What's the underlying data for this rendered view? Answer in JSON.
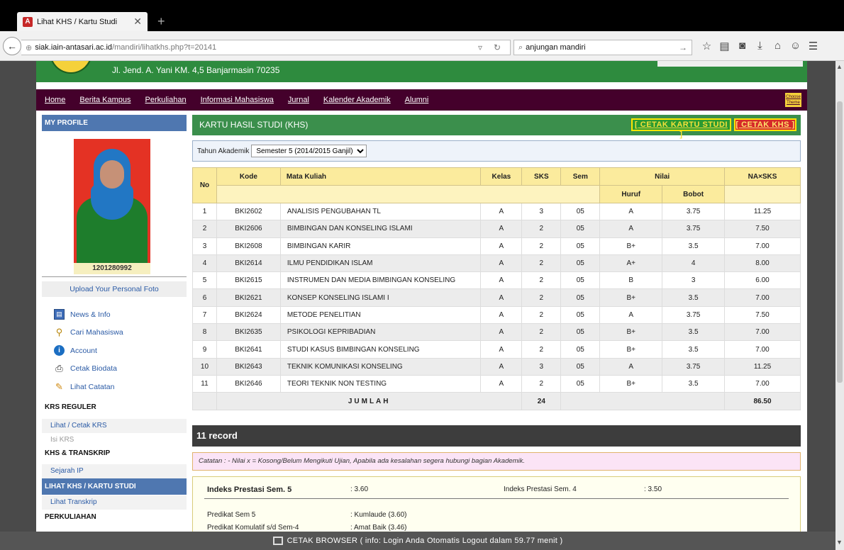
{
  "browser": {
    "tab_title": "Lihat KHS / Kartu Studi",
    "tab_favicon": "A",
    "url_host": "siak.iain-antasari.ac.id",
    "url_path": "/mandiri/lihatkhs.php?t=20141",
    "search_value": "anjungan mandiri"
  },
  "header": {
    "address": "Jl. Jend. A. Yani KM. 4,5 Banjarmasin 70235"
  },
  "menu": {
    "items": [
      "Home",
      "Berita Kampus",
      "Perkuliahan",
      "Informasi Mahasiswa",
      "Jurnal",
      "Kalender Akademik",
      "Alumni"
    ],
    "theme_label": "Choose Theme"
  },
  "sidebar": {
    "profile_title": "MY PROFILE",
    "nim": "1201280992",
    "upload_label": "Upload Your Personal Foto",
    "icon_links": [
      {
        "label": "News & Info",
        "icon": "news-icon"
      },
      {
        "label": "Cari Mahasiswa",
        "icon": "search-icon"
      },
      {
        "label": "Account",
        "icon": "account-icon"
      },
      {
        "label": "Cetak Biodata",
        "icon": "printer-icon"
      },
      {
        "label": "Lihat Catatan",
        "icon": "note-icon"
      }
    ],
    "sections": {
      "krs": "KRS REGULER",
      "krs_links": [
        "Lihat / Cetak KRS",
        "Isi KRS"
      ],
      "khs": "KHS & TRANSKRIP",
      "khs_links": [
        "Sejarah IP"
      ],
      "active": "LIHAT KHS / KARTU STUDI",
      "after_links": [
        "Lihat Transkrip"
      ],
      "next": "PERKULIAHAN"
    }
  },
  "main": {
    "title": "KARTU HASIL STUDI (KHS)",
    "cetak_kartu_label": "[ CETAK KARTU STUDI ]",
    "cetak_khs_label": "[ CETAK KHS ]",
    "filter_label": "Tahun Akademik",
    "semester_selected": "Semester 5 (2014/2015 Ganjil)",
    "table": {
      "headers": {
        "no": "No",
        "kode": "Kode",
        "mata_kuliah": "Mata Kuliah",
        "kelas": "Kelas",
        "sks": "SKS",
        "sem": "Sem",
        "nilai": "Nilai",
        "huruf": "Huruf",
        "bobot": "Bobot",
        "na_sks": "NA×SKS"
      },
      "rows": [
        {
          "no": "1",
          "kode": "BKI2602",
          "mk": "ANALISIS PENGUBAHAN TL",
          "kelas": "A",
          "sks": "3",
          "sem": "05",
          "huruf": "A",
          "bobot": "3.75",
          "na": "11.25"
        },
        {
          "no": "2",
          "kode": "BKI2606",
          "mk": "BIMBINGAN DAN KONSELING ISLAMI",
          "kelas": "A",
          "sks": "2",
          "sem": "05",
          "huruf": "A",
          "bobot": "3.75",
          "na": "7.50"
        },
        {
          "no": "3",
          "kode": "BKI2608",
          "mk": "BIMBINGAN KARIR",
          "kelas": "A",
          "sks": "2",
          "sem": "05",
          "huruf": "B+",
          "bobot": "3.5",
          "na": "7.00"
        },
        {
          "no": "4",
          "kode": "BKI2614",
          "mk": "ILMU PENDIDIKAN ISLAM",
          "kelas": "A",
          "sks": "2",
          "sem": "05",
          "huruf": "A+",
          "bobot": "4",
          "na": "8.00"
        },
        {
          "no": "5",
          "kode": "BKI2615",
          "mk": "INSTRUMEN DAN MEDIA BIMBINGAN KONSELING",
          "kelas": "A",
          "sks": "2",
          "sem": "05",
          "huruf": "B",
          "bobot": "3",
          "na": "6.00"
        },
        {
          "no": "6",
          "kode": "BKI2621",
          "mk": "KONSEP KONSELING ISLAMI I",
          "kelas": "A",
          "sks": "2",
          "sem": "05",
          "huruf": "B+",
          "bobot": "3.5",
          "na": "7.00"
        },
        {
          "no": "7",
          "kode": "BKI2624",
          "mk": "METODE PENELITIAN",
          "kelas": "A",
          "sks": "2",
          "sem": "05",
          "huruf": "A",
          "bobot": "3.75",
          "na": "7.50"
        },
        {
          "no": "8",
          "kode": "BKI2635",
          "mk": "PSIKOLOGI KEPRIBADIAN",
          "kelas": "A",
          "sks": "2",
          "sem": "05",
          "huruf": "B+",
          "bobot": "3.5",
          "na": "7.00"
        },
        {
          "no": "9",
          "kode": "BKI2641",
          "mk": "STUDI KASUS BIMBINGAN KONSELING",
          "kelas": "A",
          "sks": "2",
          "sem": "05",
          "huruf": "B+",
          "bobot": "3.5",
          "na": "7.00"
        },
        {
          "no": "10",
          "kode": "BKI2643",
          "mk": "TEKNIK KOMUNIKASI KONSELING",
          "kelas": "A",
          "sks": "3",
          "sem": "05",
          "huruf": "A",
          "bobot": "3.75",
          "na": "11.25"
        },
        {
          "no": "11",
          "kode": "BKI2646",
          "mk": "TEORI TEKNIK NON TESTING",
          "kelas": "A",
          "sks": "2",
          "sem": "05",
          "huruf": "B+",
          "bobot": "3.5",
          "na": "7.00"
        }
      ],
      "total_label": "JUMLAH",
      "total_sks": "24",
      "total_na": "86.50"
    },
    "record_count": "11 record",
    "catatan": "Catatan : - Nilai x = Kosong/Belum Mengikuti Ujian, Apabila ada kesalahan segera hubungi bagian Akademik.",
    "ip": {
      "ips_label": "Indeks Prestasi Sem. 5",
      "ips_value": ": 3.60",
      "ips_prev_label": "Indeks Prestasi Sem. 4",
      "ips_prev_value": ": 3.50",
      "predikat_label": "Predikat Sem 5",
      "predikat_value": ": Kumlaude (3.60)",
      "predikat_kum_label": "Predikat Komulatif s/d Sem-4",
      "predikat_kum_value": ": Amat Baik (3.46)"
    }
  },
  "status": {
    "text": "CETAK BROWSER ( info: Login Anda Otomatis Logout dalam 59.77 menit )"
  }
}
